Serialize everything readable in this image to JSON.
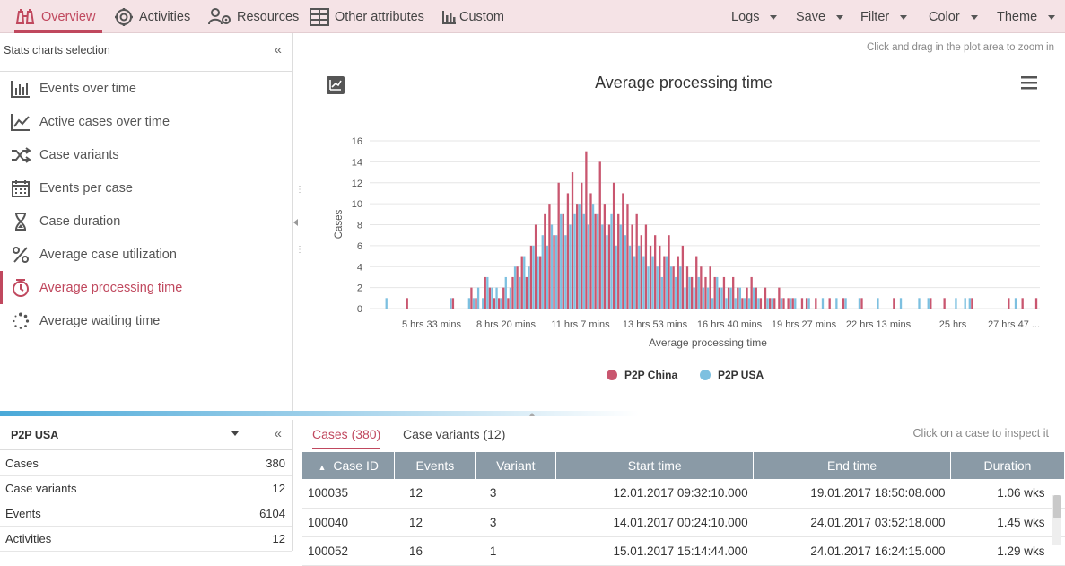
{
  "nav": {
    "overview": "Overview",
    "activities": "Activities",
    "resources": "Resources",
    "other_attributes": "Other attributes",
    "custom": "Custom",
    "logs": "Logs",
    "save": "Save",
    "filter": "Filter",
    "color": "Color",
    "theme": "Theme"
  },
  "sidebar": {
    "title": "Stats charts selection",
    "collapse": "«",
    "items": [
      {
        "label": "Events over time",
        "icon": "bar-chart-icon"
      },
      {
        "label": "Active cases over time",
        "icon": "area-chart-icon"
      },
      {
        "label": "Case variants",
        "icon": "shuffle-icon"
      },
      {
        "label": "Events per case",
        "icon": "calendar-icon"
      },
      {
        "label": "Case duration",
        "icon": "hourglass-icon"
      },
      {
        "label": "Average case utilization",
        "icon": "percent-icon"
      },
      {
        "label": "Average processing time",
        "icon": "clock-icon"
      },
      {
        "label": "Average waiting time",
        "icon": "spinner-icon"
      }
    ]
  },
  "chart_panel": {
    "zoom_hint": "Click and drag in the plot area to zoom in"
  },
  "chart_data": {
    "type": "bar",
    "title": "Average processing time",
    "xlabel": "Average processing time",
    "ylabel": "Cases",
    "ylim": [
      0,
      16
    ],
    "yticks": [
      "0",
      "2",
      "4",
      "6",
      "8",
      "10",
      "12",
      "14",
      "16"
    ],
    "xticks": [
      "5 hrs 33 mins",
      "8 hrs 20 mins",
      "11 hrs 7 mins",
      "13 hrs 53 mins",
      "16 hrs 40 mins",
      "19 hrs 27 mins",
      "22 hrs 13 mins",
      "25 hrs",
      "27 hrs 47 ..."
    ],
    "grid": true,
    "legend_position": "bottom",
    "series": [
      {
        "name": "P2P China",
        "color": "#c9566f",
        "values": [
          0,
          0,
          0,
          0,
          0,
          1,
          0,
          0,
          0,
          0,
          0,
          0,
          0,
          0,
          0,
          1,
          0,
          0,
          0,
          2,
          1,
          0,
          3,
          2,
          1,
          1,
          2,
          1,
          3,
          4,
          5,
          3,
          6,
          8,
          5,
          9,
          10,
          7,
          12,
          9,
          11,
          13,
          10,
          12,
          15,
          11,
          9,
          14,
          10,
          8,
          12,
          9,
          11,
          10,
          8,
          9,
          7,
          8,
          6,
          7,
          6,
          5,
          7,
          4,
          5,
          6,
          4,
          3,
          5,
          4,
          3,
          4,
          3,
          2,
          3,
          2,
          3,
          2,
          1,
          2,
          3,
          2,
          1,
          2,
          1,
          1,
          2,
          1,
          1,
          1,
          0,
          1,
          1,
          0,
          1,
          0,
          0,
          1,
          0,
          0,
          1,
          0,
          0,
          0,
          1,
          0,
          0,
          0,
          0,
          0,
          0,
          1,
          0,
          0,
          0,
          0,
          0,
          0,
          0,
          1,
          0,
          0,
          1,
          0,
          0,
          0,
          0,
          0,
          1,
          0,
          0,
          0,
          0,
          0,
          0,
          0,
          1,
          0,
          0,
          1,
          0,
          0,
          1
        ]
      },
      {
        "name": "P2P USA",
        "color": "#7dc0e0",
        "values": [
          1,
          0,
          0,
          0,
          0,
          0,
          0,
          0,
          0,
          0,
          0,
          0,
          0,
          0,
          1,
          0,
          0,
          0,
          1,
          1,
          2,
          1,
          3,
          2,
          2,
          1,
          3,
          2,
          4,
          3,
          5,
          4,
          6,
          5,
          7,
          6,
          8,
          7,
          9,
          7,
          8,
          9,
          10,
          9,
          8,
          10,
          9,
          8,
          7,
          9,
          6,
          8,
          7,
          6,
          5,
          6,
          5,
          4,
          5,
          4,
          3,
          5,
          4,
          3,
          4,
          2,
          3,
          2,
          3,
          2,
          2,
          1,
          3,
          2,
          1,
          2,
          1,
          2,
          1,
          1,
          2,
          1,
          0,
          1,
          1,
          0,
          1,
          0,
          1,
          1,
          0,
          0,
          1,
          0,
          0,
          1,
          0,
          0,
          1,
          0,
          1,
          0,
          0,
          1,
          0,
          0,
          0,
          1,
          0,
          0,
          0,
          0,
          1,
          0,
          0,
          0,
          1,
          0,
          1,
          0,
          0,
          0,
          0,
          0,
          1,
          0,
          1,
          1,
          0,
          0,
          0,
          0,
          0,
          0,
          0,
          0,
          0,
          1,
          0,
          0,
          0,
          0,
          0
        ]
      }
    ]
  },
  "bottom_left": {
    "log_name": "P2P USA",
    "collapse": "«",
    "stats": [
      {
        "label": "Cases",
        "value": "380"
      },
      {
        "label": "Case variants",
        "value": "12"
      },
      {
        "label": "Events",
        "value": "6104"
      },
      {
        "label": "Activities",
        "value": "12"
      }
    ]
  },
  "bottom_right": {
    "tabs": [
      "Cases (380)",
      "Case variants (12)"
    ],
    "hint": "Click on a case to inspect it",
    "columns": [
      "Case ID",
      "Events",
      "Variant",
      "Start time",
      "End time",
      "Duration"
    ],
    "rows": [
      [
        "100035",
        "12",
        "3",
        "12.01.2017 09:32:10.000",
        "19.01.2017 18:50:08.000",
        "1.06 wks"
      ],
      [
        "100040",
        "12",
        "3",
        "14.01.2017 00:24:10.000",
        "24.01.2017 03:52:18.000",
        "1.45 wks"
      ],
      [
        "100052",
        "16",
        "1",
        "15.01.2017 15:14:44.000",
        "24.01.2017 16:24:15.000",
        "1.29 wks"
      ]
    ]
  }
}
